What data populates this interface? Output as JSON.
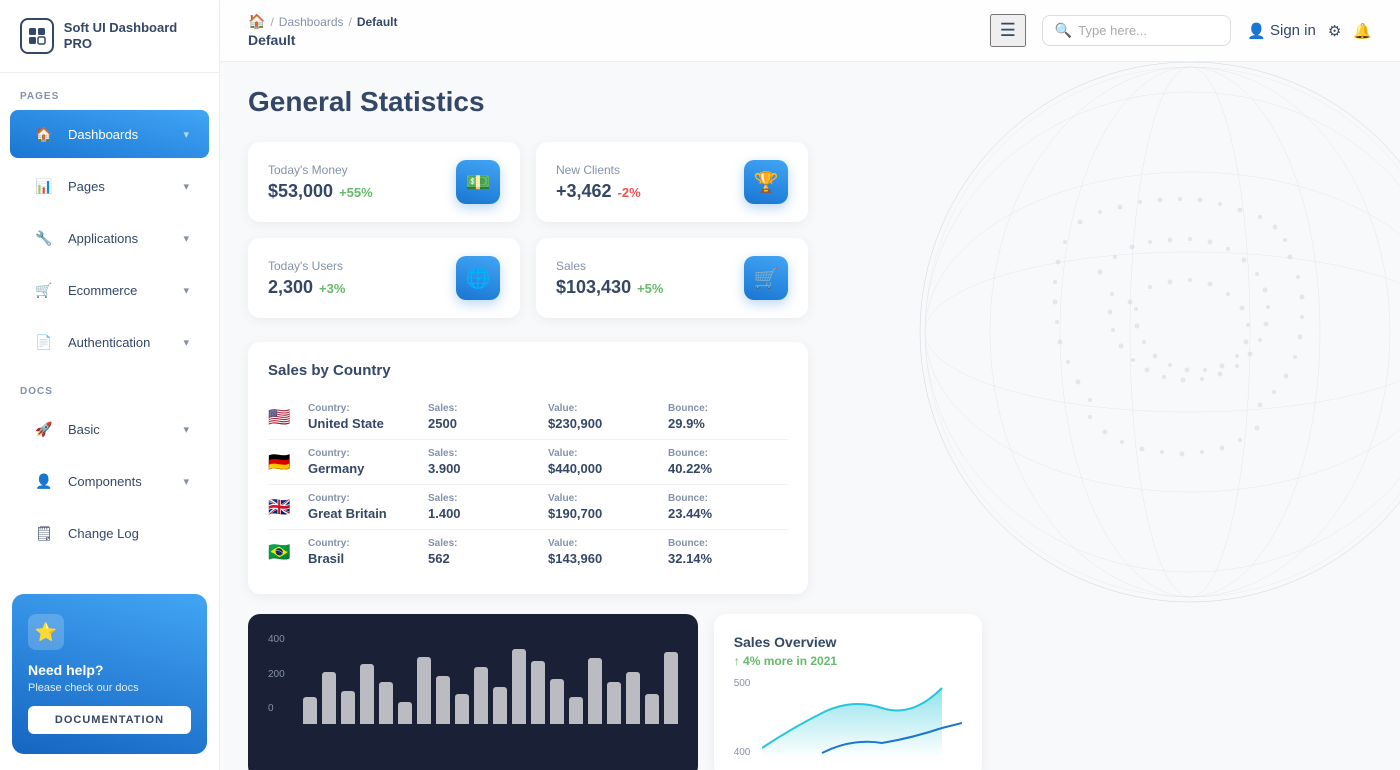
{
  "app": {
    "logo_icon": "⊞",
    "logo_text": "Soft UI Dashboard PRO"
  },
  "sidebar": {
    "pages_label": "PAGES",
    "docs_label": "DOCS",
    "items_pages": [
      {
        "id": "dashboards",
        "label": "Dashboards",
        "icon": "🏠",
        "active": true,
        "has_chevron": true
      },
      {
        "id": "pages",
        "label": "Pages",
        "icon": "📊",
        "active": false,
        "has_chevron": true
      },
      {
        "id": "applications",
        "label": "Applications",
        "icon": "🔧",
        "active": false,
        "has_chevron": true
      },
      {
        "id": "ecommerce",
        "label": "Ecommerce",
        "icon": "🛒",
        "active": false,
        "has_chevron": true
      },
      {
        "id": "authentication",
        "label": "Authentication",
        "icon": "📄",
        "active": false,
        "has_chevron": true
      }
    ],
    "items_docs": [
      {
        "id": "basic",
        "label": "Basic",
        "icon": "🚀",
        "active": false,
        "has_chevron": true
      },
      {
        "id": "components",
        "label": "Components",
        "icon": "👤",
        "active": false,
        "has_chevron": true
      },
      {
        "id": "changelog",
        "label": "Change Log",
        "icon": "🗒",
        "active": false,
        "has_chevron": false
      }
    ],
    "help": {
      "title": "Need help?",
      "subtitle": "Please check our docs",
      "btn_label": "DOCUMENTATION"
    }
  },
  "navbar": {
    "breadcrumb_home": "🏠",
    "breadcrumb_sep1": "/",
    "breadcrumb_dashboards": "Dashboards",
    "breadcrumb_sep2": "/",
    "breadcrumb_current": "Default",
    "page_title": "Default",
    "search_placeholder": "Type here...",
    "sign_in_label": "Sign in"
  },
  "main": {
    "page_heading": "General Statistics",
    "stats": [
      {
        "label": "Today's Money",
        "value": "$53,000",
        "change": "+55%",
        "change_type": "positive",
        "icon": "💵"
      },
      {
        "label": "New Clients",
        "value": "+3,462",
        "change": "-2%",
        "change_type": "negative",
        "icon": "🏆"
      },
      {
        "label": "Today's Users",
        "value": "2,300",
        "change": "+3%",
        "change_type": "positive",
        "icon": "🌐"
      },
      {
        "label": "Sales",
        "value": "$103,430",
        "change": "+5%",
        "change_type": "positive",
        "icon": "🛒"
      }
    ],
    "sales_by_country": {
      "title": "Sales by Country",
      "columns": [
        "Country:",
        "Sales:",
        "Value:",
        "Bounce:"
      ],
      "rows": [
        {
          "country": "United State",
          "flag": "🇺🇸",
          "sales": "2500",
          "value": "$230,900",
          "bounce": "29.9%"
        },
        {
          "country": "Germany",
          "flag": "🇩🇪",
          "sales": "3.900",
          "value": "$440,000",
          "bounce": "40.22%"
        },
        {
          "country": "Great Britain",
          "flag": "🇬🇧",
          "sales": "1.400",
          "value": "$190,700",
          "bounce": "23.44%"
        },
        {
          "country": "Brasil",
          "flag": "🇧🇷",
          "sales": "562",
          "value": "$143,960",
          "bounce": "32.14%"
        }
      ]
    },
    "bar_chart": {
      "y_labels": [
        "400",
        "200",
        "0"
      ],
      "bars": [
        18,
        35,
        22,
        40,
        28,
        15,
        45,
        32,
        20,
        38,
        25,
        50,
        42,
        30,
        18,
        44,
        28,
        35,
        20,
        48
      ]
    },
    "sales_overview": {
      "title": "Sales Overview",
      "subtitle": "4% more in 2021",
      "y_labels": [
        "500",
        "400"
      ]
    }
  }
}
